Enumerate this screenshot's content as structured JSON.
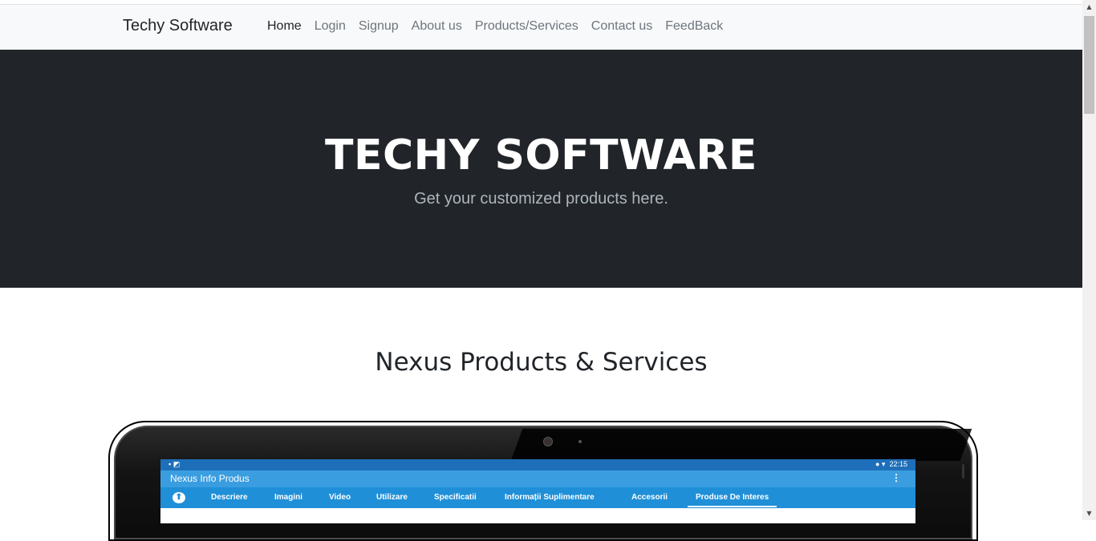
{
  "navbar": {
    "brand": "Techy Software",
    "links": [
      {
        "label": "Home",
        "active": true
      },
      {
        "label": "Login",
        "active": false
      },
      {
        "label": "Signup",
        "active": false
      },
      {
        "label": "About us",
        "active": false
      },
      {
        "label": "Products/Services",
        "active": false
      },
      {
        "label": "Contact us",
        "active": false
      },
      {
        "label": "FeedBack",
        "active": false
      }
    ]
  },
  "hero": {
    "title": "TECHY SOFTWARE",
    "subtitle": "Get your customized products here."
  },
  "section": {
    "title": "Nexus Products & Services"
  },
  "tablet_screen": {
    "status_time": "22:15",
    "app_title": "Nexus Info Produs",
    "tabs": [
      "Descriere",
      "Imagini",
      "Video",
      "Utilizare",
      "Specificatii",
      "Informații Suplimentare",
      "Accesorii",
      "Produse De Interes"
    ],
    "selected_tab": "Produse De Interes"
  },
  "colors": {
    "navbar_bg": "#f8f9fa",
    "hero_bg": "#212529",
    "hero_title": "#ffffff",
    "hero_subtitle": "#adb5bd",
    "nav_link": "#6c757d",
    "nav_link_active": "#212529",
    "app_status_bar": "#1e6fba",
    "app_bar": "#3a9de0",
    "app_tab_bar": "#1f8fd8"
  },
  "icons": {
    "app_back": "arrow-up-circle-icon",
    "app_menu": "more-vertical-icon",
    "status_icons": "status-bar-icons"
  }
}
